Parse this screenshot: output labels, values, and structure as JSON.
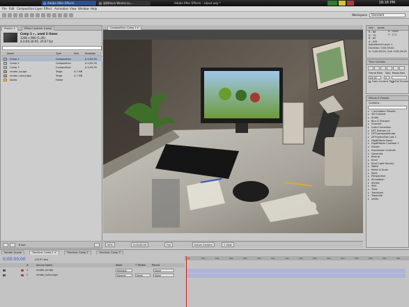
{
  "os": {
    "tabs": [
      "Adobe After Effects",
      "说明Hace Wenlei su..."
    ],
    "center_title": "Adobe After Effects - adjust.aep *",
    "clock": "18:16 PM"
  },
  "menu": [
    "File",
    "Edit",
    "Composition",
    "Layer",
    "Effect",
    "Animation",
    "View",
    "Window",
    "Help"
  ],
  "workspace": {
    "label": "Workspace",
    "value": "Standard"
  },
  "project": {
    "tab_project": "Project ×",
    "tab_effects": "Effect Controls: (none)",
    "selected_name": "Comp 1 ▾ , used 3 times",
    "selected_dims": "1280 x 960 (1.00)",
    "selected_duration": "Δ 0;00;30;00, 29.97 fps",
    "columns": [
      "Name",
      "Type",
      "Size",
      "Duration"
    ],
    "rows": [
      {
        "name": "Comp 1",
        "type": "Composition",
        "size": "",
        "duration": "Δ 0;00;30"
      },
      {
        "name": "Comp 2",
        "type": "Composition",
        "size": "",
        "duration": "Δ 0;00;30"
      },
      {
        "name": "Comp 3",
        "type": "Composition",
        "size": "",
        "duration": "Δ 0;00;30"
      },
      {
        "name": "render_ao.tga",
        "type": "Targa",
        "size": "4.7 MB",
        "duration": ""
      },
      {
        "name": "render_colour.tga",
        "type": "Targa",
        "size": "4.7 MB",
        "duration": ""
      },
      {
        "name": "Solids",
        "type": "Folder",
        "size": "",
        "duration": ""
      }
    ],
    "bpc": "8 bpc"
  },
  "viewer": {
    "tab": "Composition: Comp 1 ▾",
    "zoom": "50%",
    "time": "0;00;00;00",
    "resolution": "Full",
    "camera": "Active Camera",
    "views": "1 View"
  },
  "info": {
    "tabs": [
      "Info",
      "Audio"
    ],
    "lines": [
      "R : 86",
      "G : 79",
      "B : 63",
      "A : 255",
      "X : 1040",
      "Y : 171",
      "Adjustment Layer 1",
      "Duration: 0;00;30;00",
      "In: 0;00;00;00, Out: 0;00;29;29"
    ]
  },
  "time_controls": {
    "title": "Time Controls",
    "frame_rate_label": "Frame Rate",
    "skip_label": "Skip",
    "resolution_label": "Resolution",
    "frame_rate": "29.97",
    "skip": "0",
    "from_current": "From Current Time",
    "full_screen": "Full Screen"
  },
  "effects": {
    "title": "Effects & Presets",
    "contains_label": "Contains:",
    "items": [
      "* Animation Presets",
      "3D Channel",
      "Audio",
      "Blur & Sharpen",
      "Channel",
      "Color Correction",
      "DFT Eletrom v4",
      "DFTCompositeSuite",
      "DFTOpticsFilm Lab 2",
      "DigitEffects Basic",
      "DigitEffects Cinelook 2",
      "Distort",
      "Expression Controls",
      "Generate",
      "Keying",
      "Knoll",
      "Knoll Light Factory",
      "Matte",
      "Noise & Grain",
      "Paint",
      "Perspective",
      "Simulation",
      "Stylize",
      "Text",
      "Time",
      "Transition",
      "Trapcode",
      "Utility"
    ]
  },
  "timeline": {
    "tabs": [
      "Render Queue",
      "Timeline: Comp 1 ×",
      "Timeline: Comp 2",
      "Timeline: Comp 3"
    ],
    "timecode": "0;00;00;00",
    "fps": "(29.97 fps)",
    "header": [
      "#",
      "Source Name",
      "Mode",
      "T TrkMat",
      "Parent"
    ],
    "layers": [
      {
        "num": "1",
        "name": "render_ao.tga",
        "mode": "Multiply",
        "trkmat": "",
        "parent": "None"
      },
      {
        "num": "2",
        "name": "render_colour.tga",
        "mode": "Normal",
        "trkmat": "None",
        "parent": "None"
      }
    ],
    "ruler": [
      "0s",
      "02s",
      "04s",
      "06s",
      "08s",
      "10s",
      "12s",
      "14s",
      "16s",
      "18s",
      "20s",
      "22s",
      "24s",
      "26s",
      "28s",
      "30s"
    ]
  },
  "colors": {
    "timecode": "#2450c8",
    "layer_bar": "#aeb3d8",
    "playhead": "#d91b1b"
  }
}
